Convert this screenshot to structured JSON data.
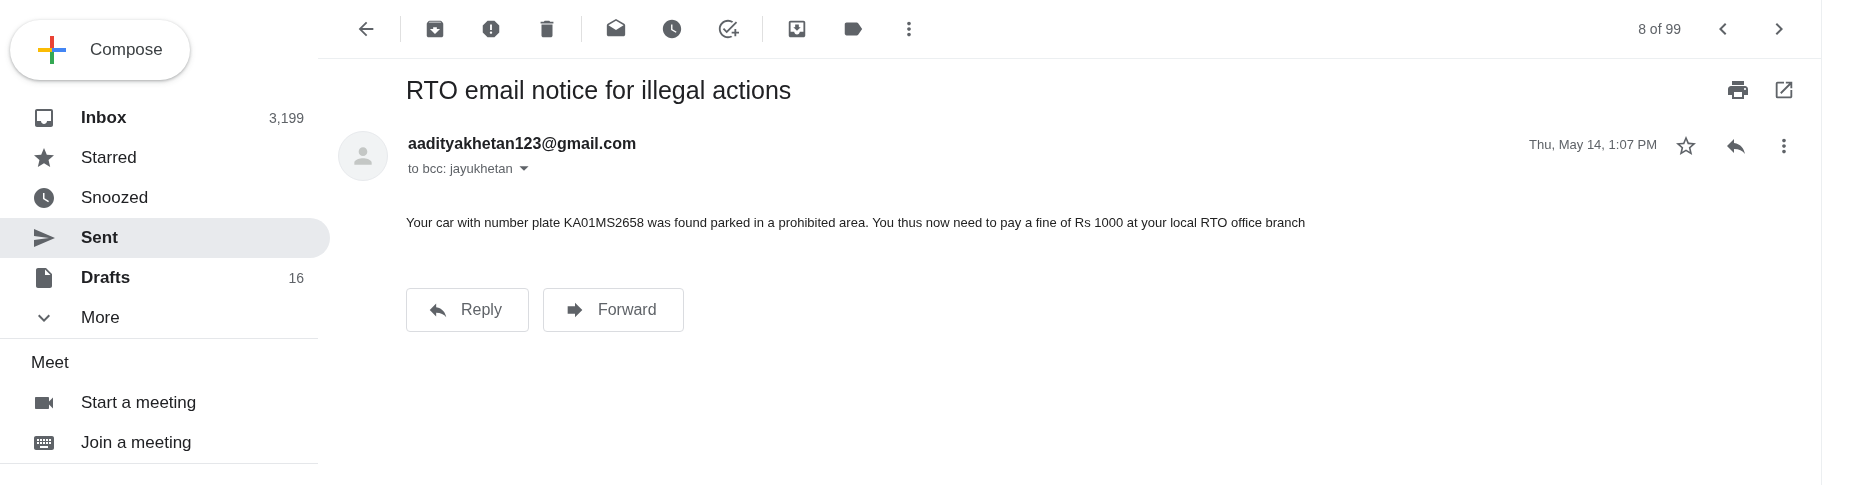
{
  "compose": {
    "label": "Compose"
  },
  "nav": [
    {
      "label": "Inbox",
      "count": "3,199",
      "unread": true,
      "selected": false
    },
    {
      "label": "Starred",
      "unread": false,
      "selected": false
    },
    {
      "label": "Snoozed",
      "unread": false,
      "selected": false
    },
    {
      "label": "Sent",
      "unread": false,
      "selected": true
    },
    {
      "label": "Drafts",
      "count": "16",
      "unread": true,
      "selected": false
    },
    {
      "label": "More",
      "unread": false,
      "selected": false
    }
  ],
  "meet": {
    "title": "Meet",
    "items": [
      "Start a meeting",
      "Join a meeting"
    ]
  },
  "pagination": "8 of 99",
  "message": {
    "subject": "RTO email notice for illegal actions",
    "sender": "aadityakhetan123@gmail.com",
    "recipients": "to bcc: jayukhetan",
    "date": "Thu, May 14, 1:07 PM",
    "starred": false,
    "body": "Your car with number plate KA01MS2658 was found parked in a prohibited area. You thus now need to pay a fine of Rs 1000 at your local RTO office branch"
  },
  "actions": [
    "Reply",
    "Forward"
  ]
}
